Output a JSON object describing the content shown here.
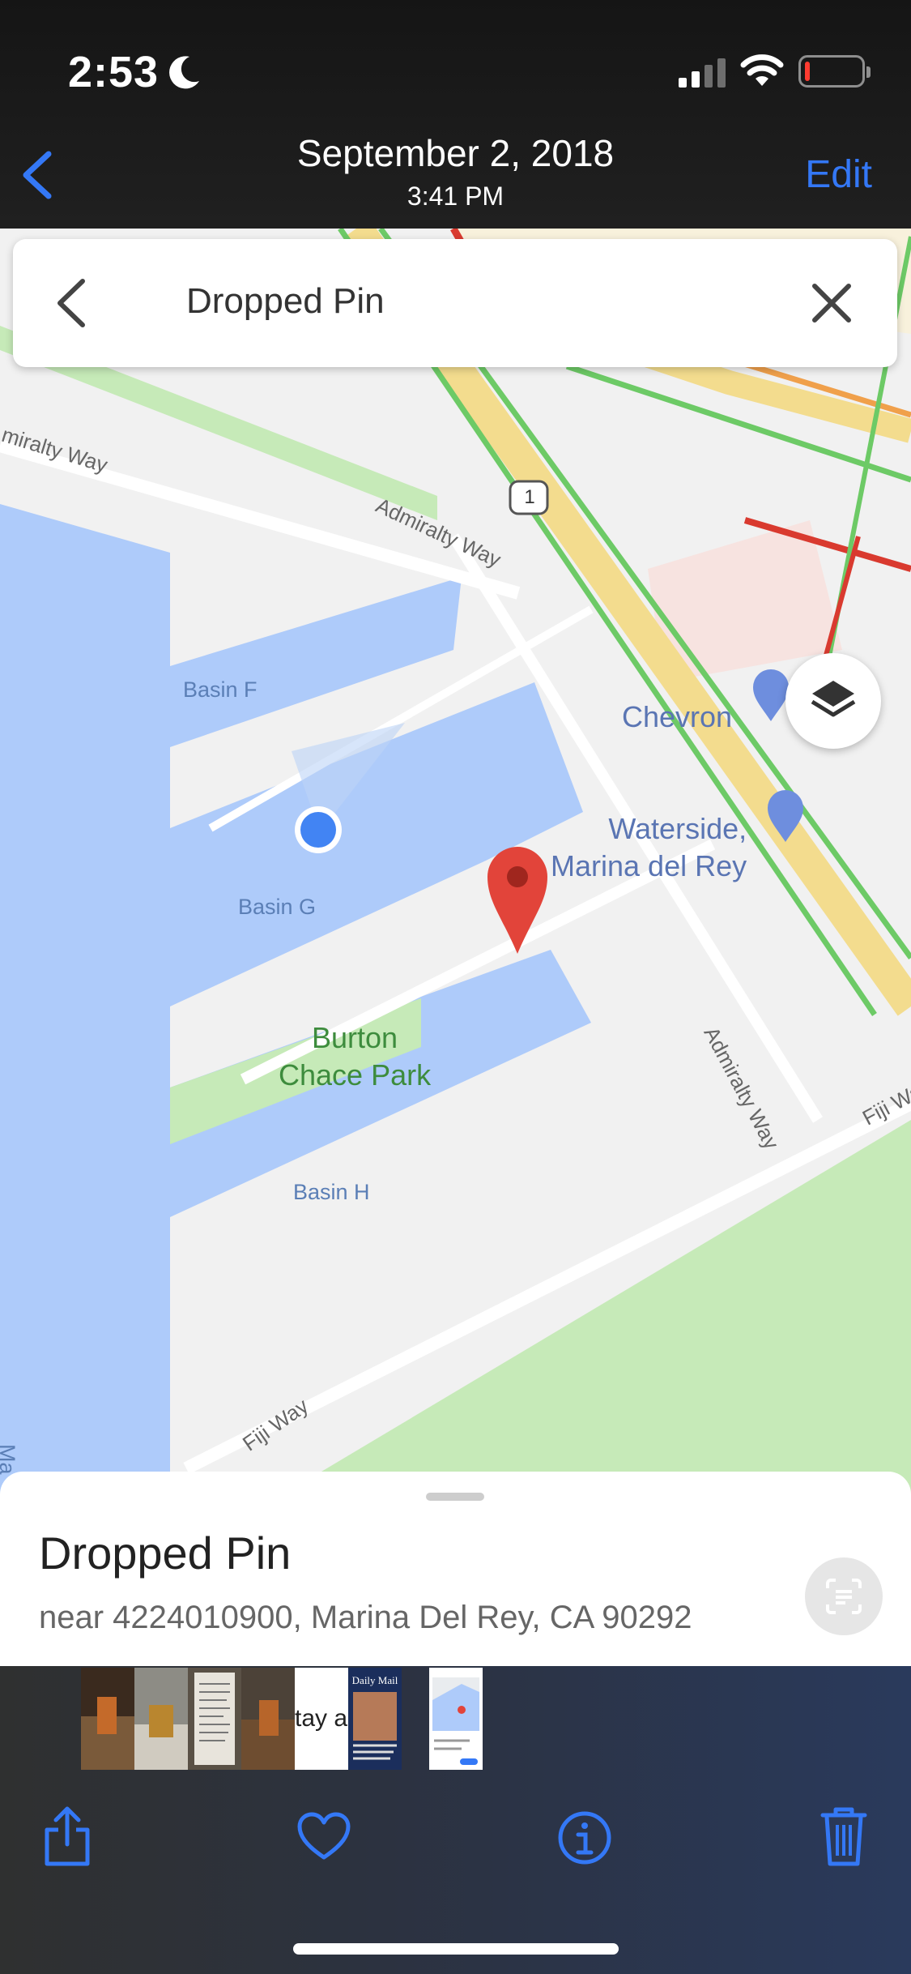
{
  "status_bar": {
    "time": "2:53"
  },
  "header": {
    "date": "September 2, 2018",
    "time": "3:41 PM",
    "edit_label": "Edit"
  },
  "map": {
    "search_query": "Dropped Pin",
    "labels": {
      "admiralty_way_left": "miralty Way",
      "admiralty_way_top": "Admiralty Way",
      "admiralty_way_right": "Admiralty Way",
      "route_shield": "1",
      "basin_f": "Basin F",
      "basin_g": "Basin G",
      "basin_h": "Basin H",
      "park": "Burton\nChace Park",
      "chevron": "Chevron",
      "waterside": "Waterside,\nMarina del Rey",
      "fiji_way_bottom": "Fiji Way",
      "fiji_way_right": "Fiji Wa",
      "edge_text": "Ma"
    }
  },
  "place_sheet": {
    "title": "Dropped Pin",
    "address": "near 4224010900, Marina Del Rey, CA 90292"
  },
  "filmstrip": {
    "text_thumb": "tay a",
    "news_thumb_masthead": "Daily Mail"
  },
  "toolbar": {
    "items": [
      "share",
      "favorite",
      "info",
      "delete"
    ]
  },
  "colors": {
    "accent": "#3478f6",
    "water": "#aecbfa",
    "park": "#c6eab8",
    "pin": "#e2443a"
  }
}
